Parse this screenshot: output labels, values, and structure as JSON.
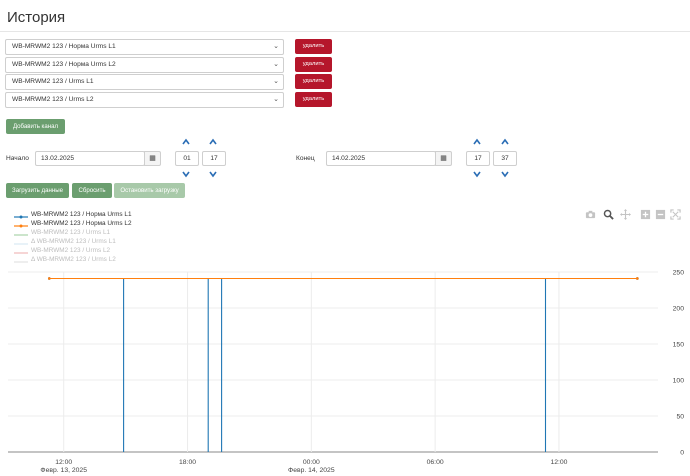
{
  "page": {
    "title": "История"
  },
  "channels": [
    {
      "label": "WB-MRWM2 123 / Норма Urms L1",
      "delete_label": "удалить"
    },
    {
      "label": "WB-MRWM2 123 / Норма Urms L2",
      "delete_label": "удалить"
    },
    {
      "label": "WB-MRWM2 123 / Urms L1",
      "delete_label": "удалить"
    },
    {
      "label": "WB-MRWM2 123 / Urms L2",
      "delete_label": "удалить"
    }
  ],
  "add_channel_label": "Добавить канал",
  "start": {
    "label": "Начало",
    "date": "13.02.2025",
    "hour": "01",
    "minute": "17"
  },
  "end": {
    "label": "Конец",
    "date": "14.02.2025",
    "hour": "17",
    "minute": "37"
  },
  "actions": {
    "load": "Загрузить данные",
    "reset": "Сбросить",
    "stop": "Остановить загрузку"
  },
  "legend": [
    {
      "name": "WB-MRWM2 123 / Норма Urms L1",
      "color": "#1f77b4",
      "dim": false
    },
    {
      "name": "WB-MRWM2 123 / Норма Urms L2",
      "color": "#ff7f0e",
      "dim": false
    },
    {
      "name": "WB-MRWM2 123 / Urms L1",
      "color": "#2ca02c",
      "dim": true
    },
    {
      "name": "Δ WB-MRWM2 123 / Urms L1",
      "color": "#9ecae1",
      "dim": true
    },
    {
      "name": "WB-MRWM2 123 / Urms L2",
      "color": "#d62728",
      "dim": true
    },
    {
      "name": "Δ WB-MRWM2 123 / Urms L2",
      "color": "#c7c7c7",
      "dim": true
    }
  ],
  "modebar": [
    "camera-icon",
    "zoom-icon",
    "pan-icon",
    "zoom-in-icon",
    "zoom-out-icon",
    "autoscale-icon"
  ],
  "chart_data": {
    "type": "line",
    "x_tick_labels": [
      {
        "t": 12,
        "label": "12:00",
        "sub": "Февр. 13, 2025"
      },
      {
        "t": 18,
        "label": "18:00",
        "sub": ""
      },
      {
        "t": 24,
        "label": "00:00",
        "sub": "Февр. 14, 2025"
      },
      {
        "t": 30,
        "label": "06:00",
        "sub": ""
      },
      {
        "t": 36,
        "label": "12:00",
        "sub": ""
      }
    ],
    "x_unit_note": "hours from Feb 13 2025 00:00",
    "xlim": [
      9.3,
      40.8
    ],
    "ylim": [
      0,
      250
    ],
    "y_ticks": [
      0,
      50,
      100,
      150,
      200,
      250
    ],
    "grid": true,
    "series": [
      {
        "name": "WB-MRWM2 123 / Норма Urms L1",
        "color": "#1f77b4",
        "x": [
          11.3,
          14.9,
          14.9,
          14.9,
          19.0,
          19.0,
          19.0,
          19.65,
          19.65,
          19.65,
          35.35,
          35.35,
          35.35,
          39.8
        ],
        "y": [
          241,
          241,
          0,
          241,
          241,
          0,
          241,
          241,
          0,
          241,
          241,
          0,
          241,
          241
        ]
      },
      {
        "name": "WB-MRWM2 123 / Норма Urms L2",
        "color": "#ff7f0e",
        "x": [
          11.3,
          39.8
        ],
        "y": [
          241,
          241
        ]
      }
    ]
  }
}
